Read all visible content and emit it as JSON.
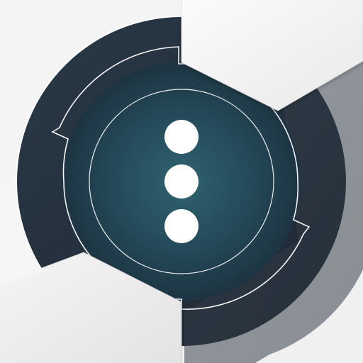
{
  "icon": {
    "glyph": "vertical-ellipsis-icon",
    "dot_count": 3
  },
  "colors": {
    "background": "#ffffff",
    "panel_light": "#f3f3f3",
    "panel_shadow": "#d9d9d9",
    "ring_dark": "#263341",
    "ring_darker": "#1f2a36",
    "center_glow": "#2e5a68",
    "center_edge": "#1f3744",
    "line": "#ffffff",
    "dot": "#ffffff"
  }
}
